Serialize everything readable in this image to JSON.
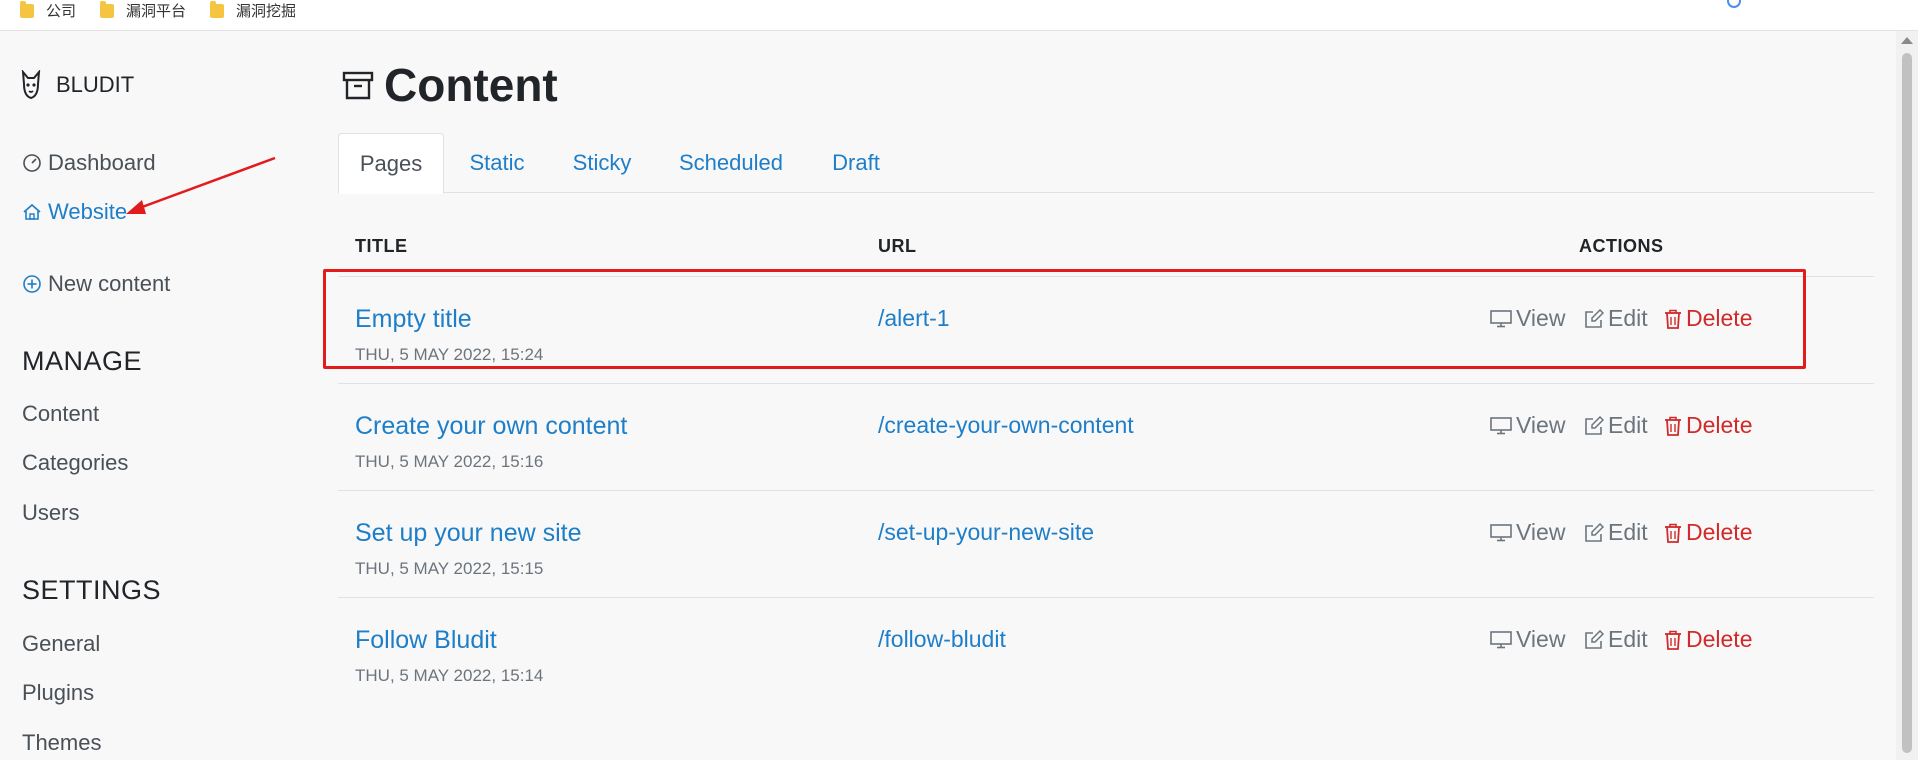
{
  "bookmarks": [
    {
      "label": "公司"
    },
    {
      "label": "漏洞平台"
    },
    {
      "label": "漏洞挖掘"
    }
  ],
  "brand": {
    "name": "BLUDIT",
    "icon": "bludit-dog-icon"
  },
  "nav": {
    "dashboard": "Dashboard",
    "website": "Website",
    "new_content": "New content"
  },
  "manage": {
    "heading": "MANAGE",
    "items": [
      "Content",
      "Categories",
      "Users"
    ]
  },
  "settings": {
    "heading": "SETTINGS",
    "items": [
      "General",
      "Plugins",
      "Themes"
    ]
  },
  "page": {
    "title": "Content",
    "icon": "archive-box-icon"
  },
  "tabs": [
    {
      "label": "Pages",
      "active": true
    },
    {
      "label": "Static",
      "active": false
    },
    {
      "label": "Sticky",
      "active": false
    },
    {
      "label": "Scheduled",
      "active": false
    },
    {
      "label": "Draft",
      "active": false
    }
  ],
  "table": {
    "headers": {
      "title": "TITLE",
      "url": "URL",
      "actions": "ACTIONS"
    },
    "action_labels": {
      "view": "View",
      "edit": "Edit",
      "delete": "Delete"
    },
    "rows": [
      {
        "title": "Empty title",
        "date": "THU, 5 MAY 2022, 15:24",
        "url": "/alert-1"
      },
      {
        "title": "Create your own content",
        "date": "THU, 5 MAY 2022, 15:16",
        "url": "/create-your-own-content"
      },
      {
        "title": "Set up your new site",
        "date": "THU, 5 MAY 2022, 15:15",
        "url": "/set-up-your-new-site"
      },
      {
        "title": "Follow Bludit",
        "date": "THU, 5 MAY 2022, 15:14",
        "url": "/follow-bludit"
      }
    ]
  },
  "colors": {
    "link": "#1e7ec7",
    "delete": "#d12a2a",
    "annotation": "#e21c1c",
    "background": "#f8f8f8"
  }
}
